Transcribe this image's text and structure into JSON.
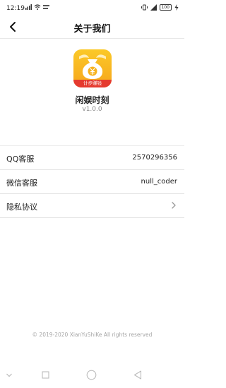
{
  "status_bar": {
    "time": "12:19",
    "battery": "100"
  },
  "header": {
    "title": "关于我们"
  },
  "app": {
    "logo_caption": "计步赚钱",
    "name": "闲娱时刻",
    "version": "v1.0.0"
  },
  "info": [
    {
      "label": "QQ客服",
      "value": "2570296356"
    },
    {
      "label": "微信客服",
      "value": "null_coder"
    },
    {
      "label": "隐私协议",
      "value": ""
    }
  ],
  "footer": {
    "copyright": "© 2019-2020 XianYuShiKe All rights reserved"
  },
  "colors": {
    "logo_top": "#fbc928",
    "logo_bottom": "#f6a51c",
    "divider": "#e6e6e6"
  }
}
